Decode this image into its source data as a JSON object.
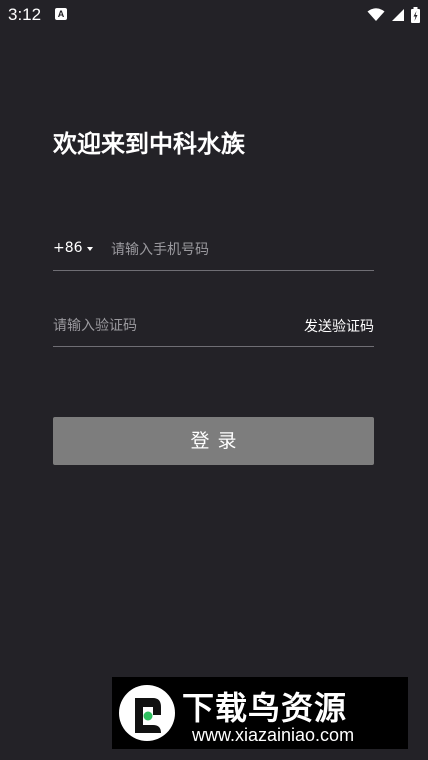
{
  "status_bar": {
    "time": "3:12",
    "app_icon_letter": "A"
  },
  "login": {
    "title": "欢迎来到中科水族",
    "country_code": "+86",
    "phone_placeholder": "请输入手机号码",
    "code_placeholder": "请输入验证码",
    "send_code_label": "发送验证码",
    "login_button_label": "登录"
  },
  "watermark": {
    "title": "下载鸟资源",
    "url": "www.xiazainiao.com"
  },
  "icons": {
    "wifi": "wifi-icon",
    "signal": "signal-icon",
    "battery": "battery-icon",
    "dropdown": "caret-down-icon",
    "logo": "bird-logo-icon"
  },
  "colors": {
    "background": "#232227",
    "button": "#7d7d7d",
    "divider": "#6f6e74",
    "placeholder": "#9a999e"
  }
}
